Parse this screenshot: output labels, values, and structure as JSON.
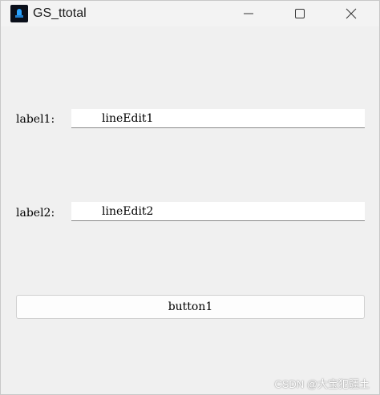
{
  "window": {
    "title": "GS_ttotal"
  },
  "form": {
    "label1": "label1:",
    "lineedit1": "lineEdit1",
    "label2": "label2:",
    "lineedit2": "lineEdit2",
    "button1": "button1"
  },
  "watermark": "CSDN @大宝犯疆土"
}
